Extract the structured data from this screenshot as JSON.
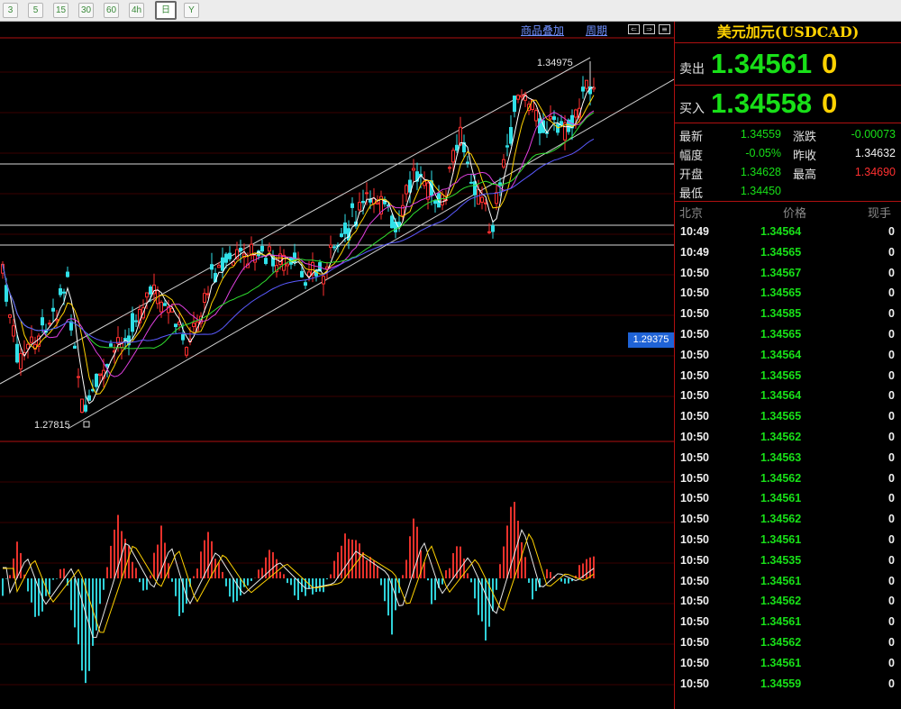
{
  "toolbar": {
    "buttons": [
      {
        "label": "3"
      },
      {
        "label": "5"
      },
      {
        "label": "15"
      },
      {
        "label": "30"
      },
      {
        "label": "60"
      },
      {
        "label": "4h"
      },
      {
        "label": "日"
      },
      {
        "label": "Y"
      }
    ]
  },
  "chart": {
    "overlay_link": "商品叠加",
    "period_link": "周期",
    "high_marker": "1.34975",
    "low_marker": "1.27815",
    "cursor_price": "1.29375"
  },
  "panel": {
    "title": "美元加元(USDCAD)",
    "sell": {
      "label": "卖出",
      "price": "1.34561",
      "vol": "0"
    },
    "buy": {
      "label": "买入",
      "price": "1.34558",
      "vol": "0"
    },
    "stats": {
      "latest_label": "最新",
      "latest": "1.34559",
      "change_label": "涨跌",
      "change": "-0.00073",
      "pct_label": "幅度",
      "pct": "-0.05%",
      "prev_label": "昨收",
      "prev": "1.34632",
      "open_label": "开盘",
      "open": "1.34628",
      "high_label": "最高",
      "high": "1.34690",
      "low_label": "最低",
      "low": "1.34450"
    },
    "ticks_header": {
      "time": "北京",
      "price": "价格",
      "vol": "现手"
    },
    "ticks": [
      {
        "time": "10:49",
        "price": "1.34564",
        "vol": "0"
      },
      {
        "time": "10:49",
        "price": "1.34565",
        "vol": "0"
      },
      {
        "time": "10:50",
        "price": "1.34567",
        "vol": "0"
      },
      {
        "time": "10:50",
        "price": "1.34565",
        "vol": "0"
      },
      {
        "time": "10:50",
        "price": "1.34585",
        "vol": "0"
      },
      {
        "time": "10:50",
        "price": "1.34565",
        "vol": "0"
      },
      {
        "time": "10:50",
        "price": "1.34564",
        "vol": "0"
      },
      {
        "time": "10:50",
        "price": "1.34565",
        "vol": "0"
      },
      {
        "time": "10:50",
        "price": "1.34564",
        "vol": "0"
      },
      {
        "time": "10:50",
        "price": "1.34565",
        "vol": "0"
      },
      {
        "time": "10:50",
        "price": "1.34562",
        "vol": "0"
      },
      {
        "time": "10:50",
        "price": "1.34563",
        "vol": "0"
      },
      {
        "time": "10:50",
        "price": "1.34562",
        "vol": "0"
      },
      {
        "time": "10:50",
        "price": "1.34561",
        "vol": "0"
      },
      {
        "time": "10:50",
        "price": "1.34562",
        "vol": "0"
      },
      {
        "time": "10:50",
        "price": "1.34561",
        "vol": "0"
      },
      {
        "time": "10:50",
        "price": "1.34535",
        "vol": "0"
      },
      {
        "time": "10:50",
        "price": "1.34561",
        "vol": "0"
      },
      {
        "time": "10:50",
        "price": "1.34562",
        "vol": "0"
      },
      {
        "time": "10:50",
        "price": "1.34561",
        "vol": "0"
      },
      {
        "time": "10:50",
        "price": "1.34562",
        "vol": "0"
      },
      {
        "time": "10:50",
        "price": "1.34561",
        "vol": "0"
      },
      {
        "time": "10:50",
        "price": "1.34559",
        "vol": "0"
      }
    ]
  },
  "colors": {
    "up": "#ff3030",
    "down": "#18e018",
    "macd_pos": "#e8312b",
    "macd_neg": "#2fd0d8",
    "accent": "#ffd200"
  }
}
